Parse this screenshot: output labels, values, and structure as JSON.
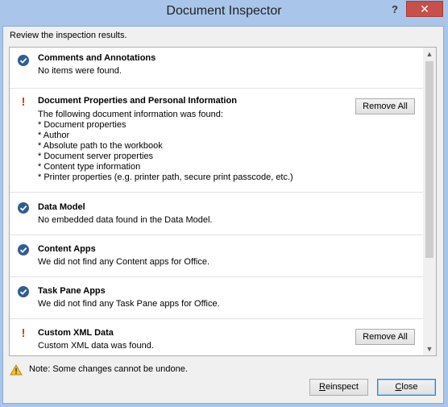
{
  "window": {
    "title": "Document Inspector",
    "help_label": "?",
    "close_label": "✕"
  },
  "instruction": "Review the inspection results.",
  "sections": [
    {
      "status": "ok",
      "title": "Comments and Annotations",
      "lines": "No items were found."
    },
    {
      "status": "found",
      "title": "Document Properties and Personal Information",
      "lines": "The following document information was found:\n* Document properties\n* Author\n* Absolute path to the workbook\n* Document server properties\n* Content type information\n* Printer properties (e.g. printer path, secure print passcode, etc.)",
      "button": "Remove All"
    },
    {
      "status": "ok",
      "title": "Data Model",
      "lines": "No embedded data found in the Data Model."
    },
    {
      "status": "ok",
      "title": "Content Apps",
      "lines": "We did not find any Content apps for Office."
    },
    {
      "status": "ok",
      "title": "Task Pane Apps",
      "lines": "We did not find any Task Pane apps for Office."
    },
    {
      "status": "found",
      "title": "Custom XML Data",
      "lines": "Custom XML data was found.",
      "button": "Remove All"
    }
  ],
  "note": "Note: Some changes cannot be undone.",
  "buttons": {
    "reinspect_accel": "R",
    "reinspect_rest": "einspect",
    "close_accel": "C",
    "close_rest": "lose"
  },
  "colors": {
    "ok_icon": "#2f5d93",
    "found_icon": "#d0451b",
    "titlebar": "#a9c6ea",
    "close_button": "#c7504b"
  },
  "icons": {
    "ok": "check-circle-icon",
    "found": "exclamation-icon",
    "note": "warning-icon"
  }
}
